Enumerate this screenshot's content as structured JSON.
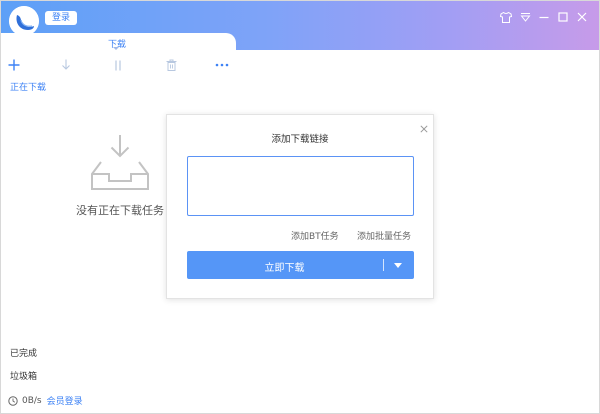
{
  "header": {
    "login_label": "登录",
    "colors": {
      "gradient_start": "#5da0f7",
      "gradient_end": "#c79be9",
      "accent": "#3d82f5"
    }
  },
  "window_controls": [
    {
      "icon": "tshirt-icon"
    },
    {
      "icon": "dropdown-menu-icon"
    },
    {
      "icon": "minimize-icon"
    },
    {
      "icon": "maximize-icon"
    },
    {
      "icon": "close-icon"
    }
  ],
  "tabs": {
    "active_label": "下载"
  },
  "toolbar": [
    {
      "icon": "add-icon"
    },
    {
      "icon": "download-icon"
    },
    {
      "icon": "pause-icon"
    },
    {
      "icon": "delete-icon"
    },
    {
      "icon": "more-icon"
    }
  ],
  "sidebar": {
    "downloading_label": "正在下载",
    "completed_label": "已完成",
    "trash_label": "垃圾箱"
  },
  "empty_state": {
    "text": "没有正在下载任务"
  },
  "status_bar": {
    "speed": "0B/s",
    "member_login": "会员登录"
  },
  "dialog": {
    "title": "添加下载链接",
    "link_input_value": "",
    "add_bt_label": "添加BT任务",
    "add_batch_label": "添加批量任务",
    "download_now_label": "立即下载",
    "primary_color": "#5596f7"
  }
}
